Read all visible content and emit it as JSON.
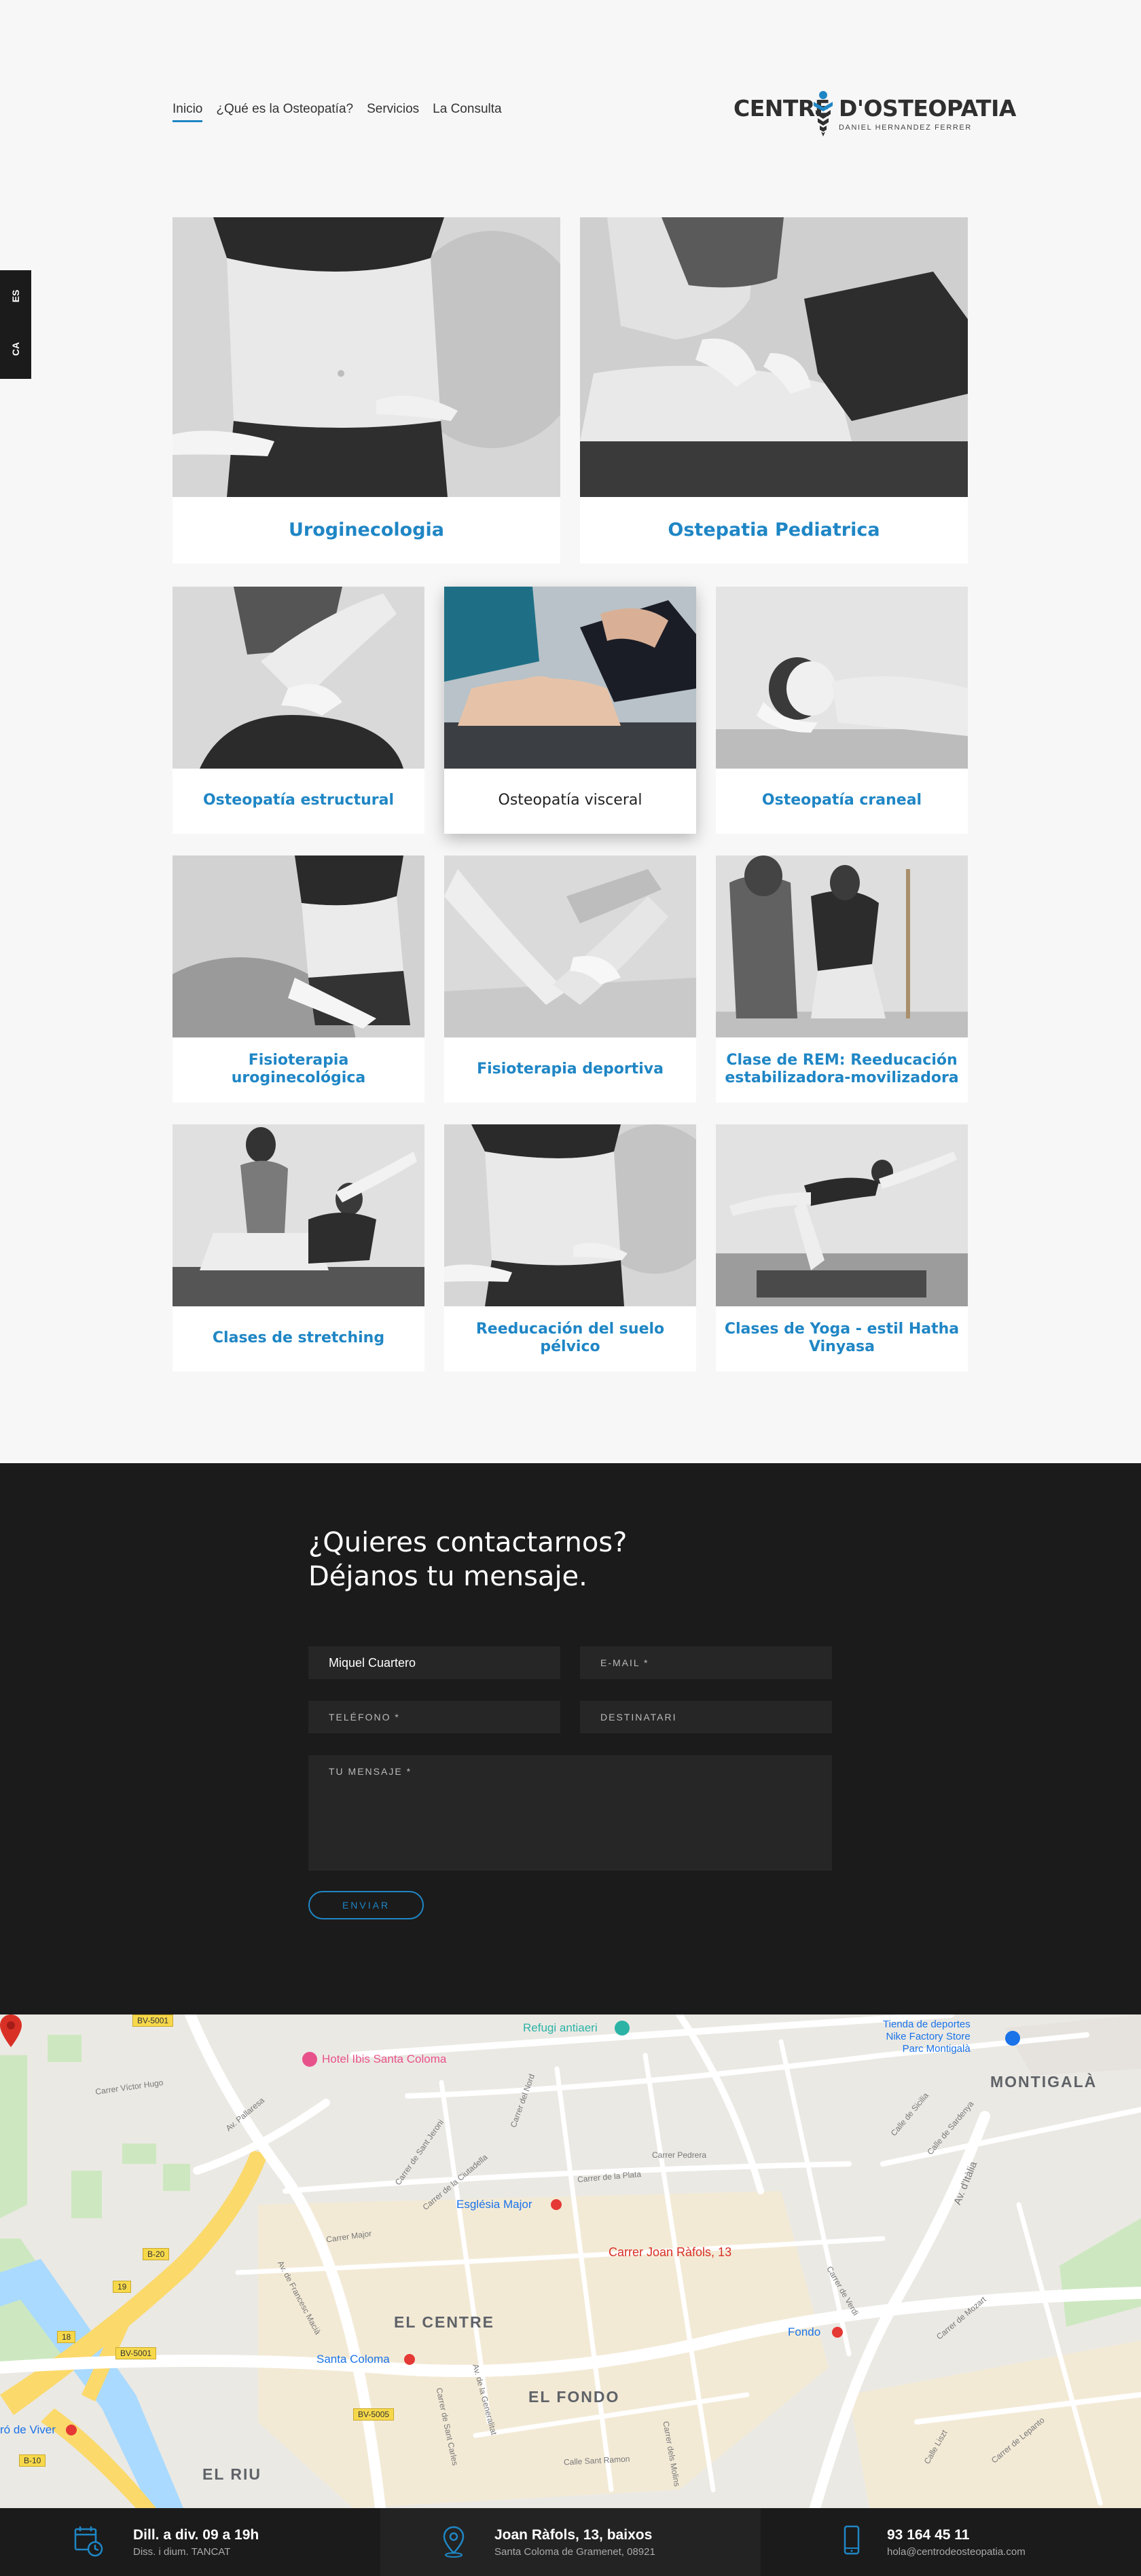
{
  "nav": {
    "items": [
      "Inicio",
      "¿Qué es la Osteopatía?",
      "Servicios",
      "La Consulta"
    ],
    "active": "Inicio"
  },
  "logo": {
    "word1": "CENTRE",
    "word2": "D'OSTEOPATIA",
    "subtitle": "DANIEL HERNANDEZ FERRER"
  },
  "lang": {
    "es": "ES",
    "ca": "CA"
  },
  "services": [
    {
      "label": "Uroginecologia",
      "icon": "photo-abdomen"
    },
    {
      "label": "Ostepatia Pediatrica",
      "icon": "photo-abdomen-massage"
    },
    {
      "label": "Osteopatía estructural",
      "icon": "photo-leg-stretch"
    },
    {
      "label": "Osteopatía visceral",
      "icon": "photo-visceral-color",
      "highlighted": true
    },
    {
      "label": "Osteopatía craneal",
      "icon": "photo-head"
    },
    {
      "label": "Fisioterapia uroginecológica",
      "icon": "photo-ball"
    },
    {
      "label": "Fisioterapia deportiva",
      "icon": "photo-knee"
    },
    {
      "label": "Clase de REM: Reeducación estabilizadora-movilizadora",
      "icon": "photo-standing"
    },
    {
      "label": "Clases de stretching",
      "icon": "photo-stretch-class"
    },
    {
      "label": "Reeducación del suelo pélvico",
      "icon": "photo-abdomen"
    },
    {
      "label": "Clases de Yoga - estil Hatha Vinyasa",
      "icon": "photo-yoga"
    }
  ],
  "contact": {
    "heading_line1": "¿Quieres contactarnos?",
    "heading_line2": "Déjanos tu mensaje.",
    "name_value": "Miquel Cuartero",
    "email_placeholder": "E-MAIL *",
    "phone_placeholder": "TELÉFONO *",
    "recipient_placeholder": "DESTINATARI",
    "message_placeholder": "TU MENSAJE *",
    "submit_label": "ENVIAR"
  },
  "map": {
    "pois": {
      "hotel": "Hotel Ibis Santa Coloma",
      "refugi": "Refugi antiaeri",
      "nike": "Tienda de deportes\nNike Factory Store\nParc Montigalà",
      "esglesia": "Església Major",
      "fondo_metro": "Fondo",
      "santa_coloma": "Santa Coloma",
      "viver": "ró de Viver",
      "address_pin": "Carrer Joan Ràfols, 13"
    },
    "districts": {
      "centre": "EL CENTRE",
      "fondo": "EL FONDO",
      "riu": "EL RIU",
      "montigala": "MONTIGALÀ"
    },
    "streets": {
      "pallaresa": "Av. Pallaresa",
      "francesc": "Av. de Francesc Macià",
      "victor_hugo": "Carrer Víctor Hugo",
      "pedrera": "Carrer Pedrera",
      "plata": "Carrer de la Plata",
      "major": "Carrer Major",
      "santjeroni": "Carrer de Sant Jeroni",
      "ciutadella": "Carrer de la Ciutadella",
      "sicilia": "Calle de Sicilia",
      "sardenya": "Calle de Sardenya",
      "italia": "Av. d'Itàlia",
      "mozart": "Carrer de Mozart",
      "verdi": "Carrer de Verdi",
      "lepanto": "Carrer de Lepanto",
      "liszt": "Calle Liszt",
      "nord": "Carrer del Nord",
      "sant_carles": "Carrer de Sant Carles",
      "generalitat": "Av. de la Generalitat",
      "sant_ramon": "Calle Sant Ramon",
      "molins": "Carrer dels Molins",
      "bv5001": "BV-5001",
      "bv5005": "BV-5005",
      "b20": "B-20",
      "b10": "B-10",
      "r19": "19",
      "r18": "18"
    }
  },
  "footer": {
    "hours_title": "Dill. a div. 09 a 19h",
    "hours_sub": "Diss. i dium. TANCAT",
    "address_title": "Joan Ràfols, 13, baixos",
    "address_sub": "Santa Coloma de Gramenet, 08921",
    "phone_title": "93 164 45 11",
    "email": "hola@centrodeosteopatia.com"
  },
  "colors": {
    "accent": "#1f86c5",
    "dark": "#1b1b1b",
    "pin": "#d93025"
  }
}
